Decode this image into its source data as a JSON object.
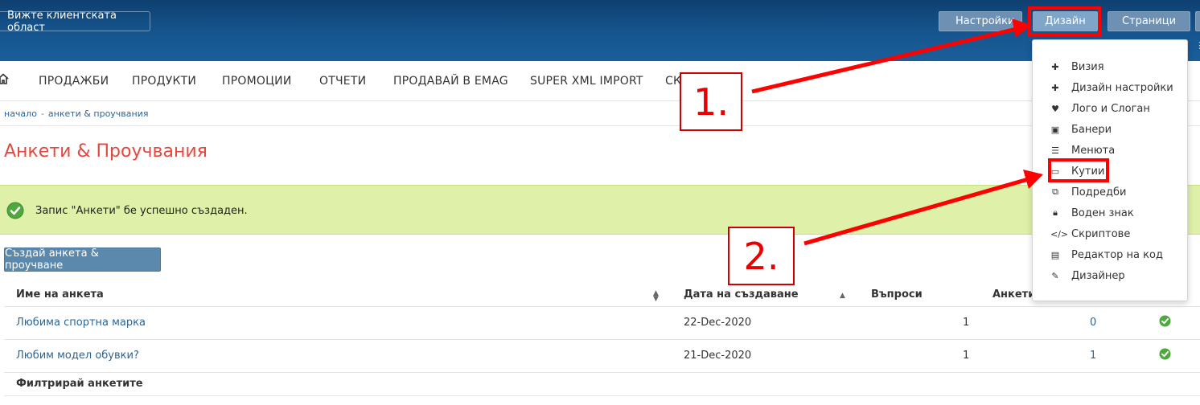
{
  "topbar": {
    "client_area_label": "Вижте клиентската област",
    "settings_label": "Настройки",
    "design_label": "Дизайн",
    "pages_label": "Страници",
    "dots": "⋮"
  },
  "nav": {
    "items": [
      "ПРОДАЖБИ",
      "ПРОДУКТИ",
      "ПРОМОЦИИ",
      "ОТЧЕТИ",
      "ПРОДАВАЙ В EMAG",
      "SUPER XML IMPORT",
      "СК"
    ]
  },
  "breadcrumb": {
    "home": "начало",
    "separator": "-",
    "current": "анкети & проучвания"
  },
  "page": {
    "title": "Анкети & Проучвания",
    "alert": "Запис \"Анкети\" бе успешно създаден.",
    "create_button": "Създай анкета & проучване",
    "filter_title": "Филтрирай анкетите"
  },
  "table": {
    "headers": [
      "Име на анкета",
      "Дата на създаване",
      "Въпроси",
      "Анкети"
    ],
    "rows": [
      {
        "name": "Любима спортна марка",
        "date": "22-Dec-2020",
        "questions": "1",
        "count": "0"
      },
      {
        "name": "Любим модел обувки?",
        "date": "21-Dec-2020",
        "questions": "1",
        "count": "1"
      }
    ]
  },
  "dropdown": {
    "items": [
      {
        "label": "Визия",
        "icon": "puzzle-icon"
      },
      {
        "label": "Дизайн настройки",
        "icon": "puzzle-icon"
      },
      {
        "label": "Лого и Слоган",
        "icon": "heart-icon"
      },
      {
        "label": "Банери",
        "icon": "image-icon"
      },
      {
        "label": "Менюта",
        "icon": "list-icon"
      },
      {
        "label": "Кутии",
        "icon": "box-icon"
      },
      {
        "label": "Подредби",
        "icon": "arrange-icon"
      },
      {
        "label": "Воден знак",
        "icon": "lock-icon"
      },
      {
        "label": "Скриптове",
        "icon": "code-icon"
      },
      {
        "label": "Редактор на код",
        "icon": "editor-icon"
      },
      {
        "label": "Дизайнер",
        "icon": "brush-icon"
      }
    ]
  },
  "annotations": {
    "step1": "1.",
    "step2": "2.",
    "color": "#ff0000"
  },
  "colors": {
    "title": "#e8473e",
    "alert_bg": "#dff0a8",
    "topbar": "#16568f",
    "link": "#2a6496",
    "button": "#5b88ad"
  }
}
